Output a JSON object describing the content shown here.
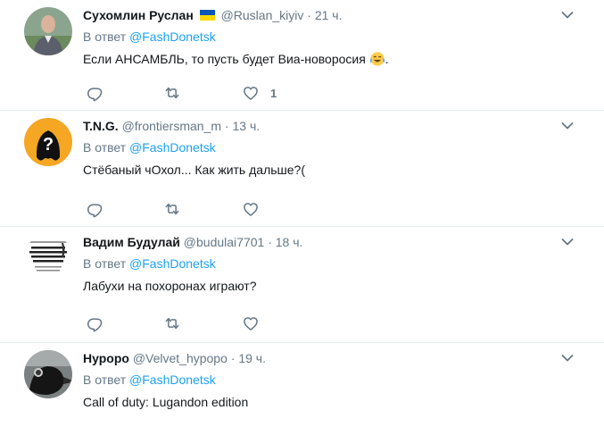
{
  "tweets": [
    {
      "name": "Сухомлин Руслан",
      "handle": "@Ruslan_kiyiv",
      "dot": "·",
      "time": "21 ч.",
      "reply_prefix": "В ответ",
      "reply_to": "@FashDonetsk",
      "text": "Если АНСАМБЛЬ, то пусть будет Виа-новоросия",
      "text_suffix": ".",
      "like_count": "1",
      "flag_colors": [
        "#0057b7",
        "#ffd700"
      ]
    },
    {
      "name": "T.N.G.",
      "handle": "@frontiersman_m",
      "dot": "·",
      "time": "13 ч.",
      "reply_prefix": "В ответ",
      "reply_to": "@FashDonetsk",
      "text": "Стёбаный чОхол... Как жить дальше?(",
      "avatar_glyph": "?"
    },
    {
      "name": "Вадим Будулай",
      "handle": "@budulai7701",
      "dot": "·",
      "time": "18 ч.",
      "reply_prefix": "В ответ",
      "reply_to": "@FashDonetsk",
      "text": "Лабухи на похоронах играют?"
    },
    {
      "name": "Нуроро",
      "handle": "@Velvet_hypopo",
      "dot": "·",
      "time": "19 ч.",
      "reply_prefix": "В ответ",
      "reply_to": "@FashDonetsk",
      "text": "Call of duty: Lugandon edition"
    }
  ],
  "icons": {
    "reply": "reply-icon",
    "retweet": "retweet-icon",
    "like": "like-icon",
    "more": "chevron-down-icon"
  },
  "colors": {
    "link": "#1da1f2",
    "secondary_text": "#657786",
    "icon": "#657786",
    "divider": "#e6ecf0"
  }
}
